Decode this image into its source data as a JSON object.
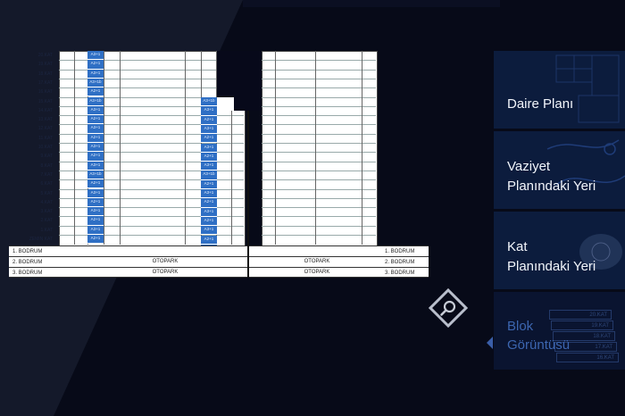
{
  "floors": [
    "20.KAT",
    "19.KAT",
    "18.KAT",
    "17.KAT",
    "16.KAT",
    "15.KAT",
    "14.KAT",
    "13.KAT",
    "12.KAT",
    "11.KAT",
    "10.KAT",
    "9.KAT",
    "8.KAT",
    "7.KAT",
    "6.KAT",
    "5.KAT",
    "4.KAT",
    "3.KAT",
    "2.KAT",
    "1.KAT",
    "ZEMIN KAT"
  ],
  "left_units": [
    "A3+1",
    "A2+1",
    "A3+1",
    "A3+1b",
    "A2+1",
    "A3+1b",
    "A3+1",
    "A2+1",
    "A3+1",
    "A2+1",
    "A3+1",
    "A2+1",
    "A3+1",
    "A3+1b",
    "A2+1",
    "A3+1",
    "A2+1",
    "A3+1",
    "A2+1",
    "A3+1",
    "A2+1"
  ],
  "middle_units": [
    "A3+1b",
    "A3+1",
    "A2+1",
    "A3+1",
    "A2+1",
    "A3+1",
    "A2+1",
    "A3+1",
    "A3+1b",
    "A2+1",
    "A3+1",
    "A2+1",
    "A3+1",
    "A2+1",
    "A3+1",
    "A2+1",
    "A3+1"
  ],
  "basements": {
    "b1_left": "1. BODRUM",
    "b2_left": "2. BODRUM",
    "b3_left": "3. BODRUM",
    "b1_right": "1. BODRUM",
    "b2_right": "2. BODRUM",
    "b3_right": "3. BODRUM",
    "otopark_left_2": "OTOPARK",
    "otopark_left_3": "OTOPARK",
    "otopark_right_2": "OTOPARK",
    "otopark_right_3": "OTOPARK"
  },
  "menu": {
    "item1": "Daire Planı",
    "item2_line1": "Vaziyet",
    "item2_line2": "Planındaki Yeri",
    "item3_line1": "Kat",
    "item3_line2": "Planındaki Yeri",
    "item4_line1": "Blok",
    "item4_line2": "Görüntüsü",
    "deco_floors": [
      "20.KAT",
      "19.KAT",
      "18.KAT",
      "17.KAT",
      "16.KAT"
    ]
  },
  "colors": {
    "background": "#070a18",
    "unit_blue": "#2f6fc4",
    "menu_bg": "#0c1c3d",
    "active_text": "#3c66b0"
  }
}
